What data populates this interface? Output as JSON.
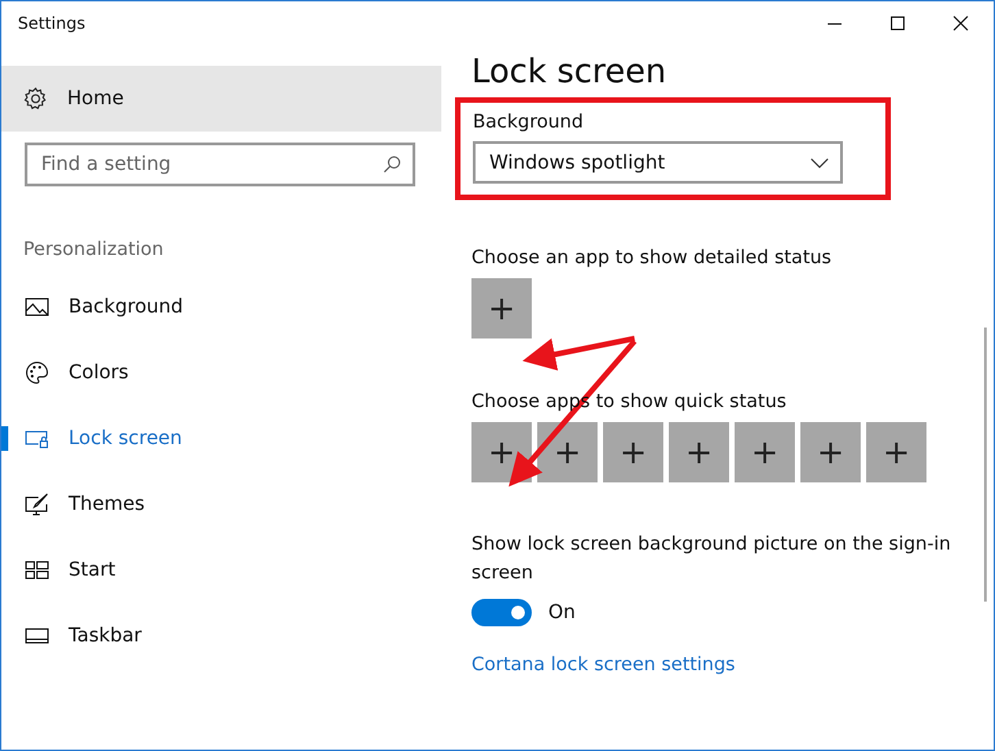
{
  "window": {
    "title": "Settings"
  },
  "sidebar": {
    "home": "Home",
    "search": {
      "placeholder": "Find a setting"
    },
    "section": "Personalization",
    "items": [
      {
        "label": "Background",
        "kind": "background",
        "selected": false
      },
      {
        "label": "Colors",
        "kind": "colors",
        "selected": false
      },
      {
        "label": "Lock screen",
        "kind": "lock",
        "selected": true
      },
      {
        "label": "Themes",
        "kind": "themes",
        "selected": false
      },
      {
        "label": "Start",
        "kind": "start",
        "selected": false
      },
      {
        "label": "Taskbar",
        "kind": "taskbar",
        "selected": false
      }
    ]
  },
  "content": {
    "title": "Lock screen",
    "background": {
      "label": "Background",
      "value": "Windows spotlight"
    },
    "detailed_status": {
      "label": "Choose an app to show detailed status",
      "tiles": [
        "+"
      ]
    },
    "quick_status": {
      "label": "Choose apps to show quick status",
      "tiles": [
        "+",
        "+",
        "+",
        "+",
        "+",
        "+",
        "+"
      ]
    },
    "signin_picture": {
      "label": "Show lock screen background picture on the sign-in screen",
      "on": true,
      "state_text": "On"
    },
    "link": "Cortana lock screen settings"
  }
}
